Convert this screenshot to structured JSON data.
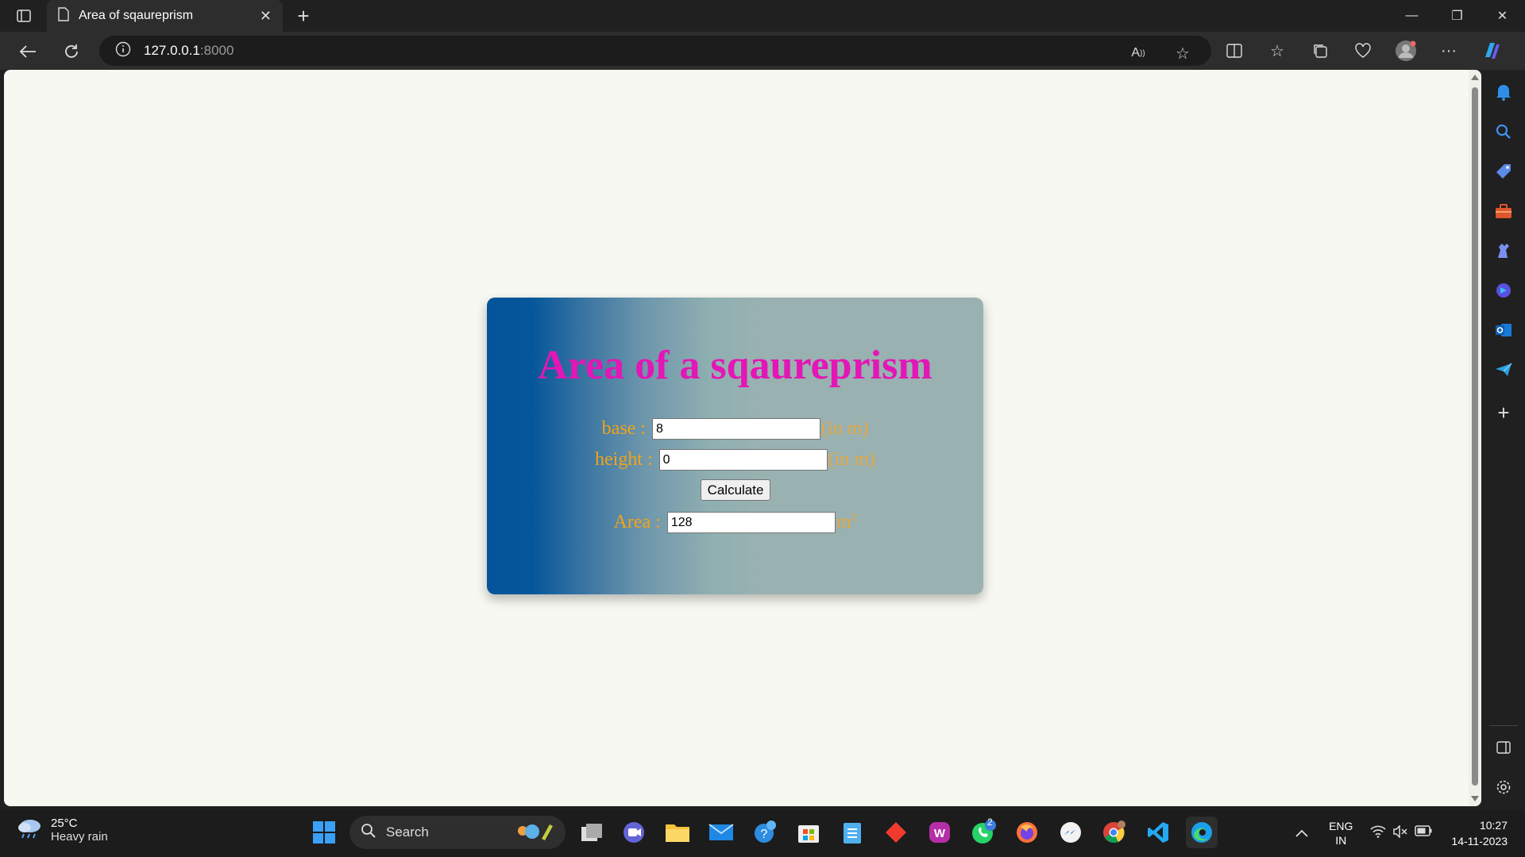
{
  "browser": {
    "tab_title": "Area of sqaureprism",
    "url_host": "127.0.0.1",
    "url_port": ":8000"
  },
  "page": {
    "heading": "Area of a sqaureprism",
    "base_label": "base :",
    "base_value": "8",
    "base_unit": "(in m)",
    "height_label": "height :",
    "height_value": "0",
    "height_unit": "(in m)",
    "calculate_label": "Calculate",
    "area_label": "Area :",
    "area_value": "128",
    "area_unit": "m",
    "area_unit_exp": "2"
  },
  "taskbar": {
    "temperature": "25°C",
    "weather": "Heavy rain",
    "search_label": "Search",
    "whatsapp_badge": "2",
    "lang": "ENG",
    "region": "IN",
    "time": "10:27",
    "date": "14-11-2023"
  },
  "colors": {
    "heading": "#e316b6",
    "label": "#f4a316",
    "card_left": "#04549b",
    "card_right": "#99b1b1",
    "page_bg": "#f8f8f2"
  }
}
